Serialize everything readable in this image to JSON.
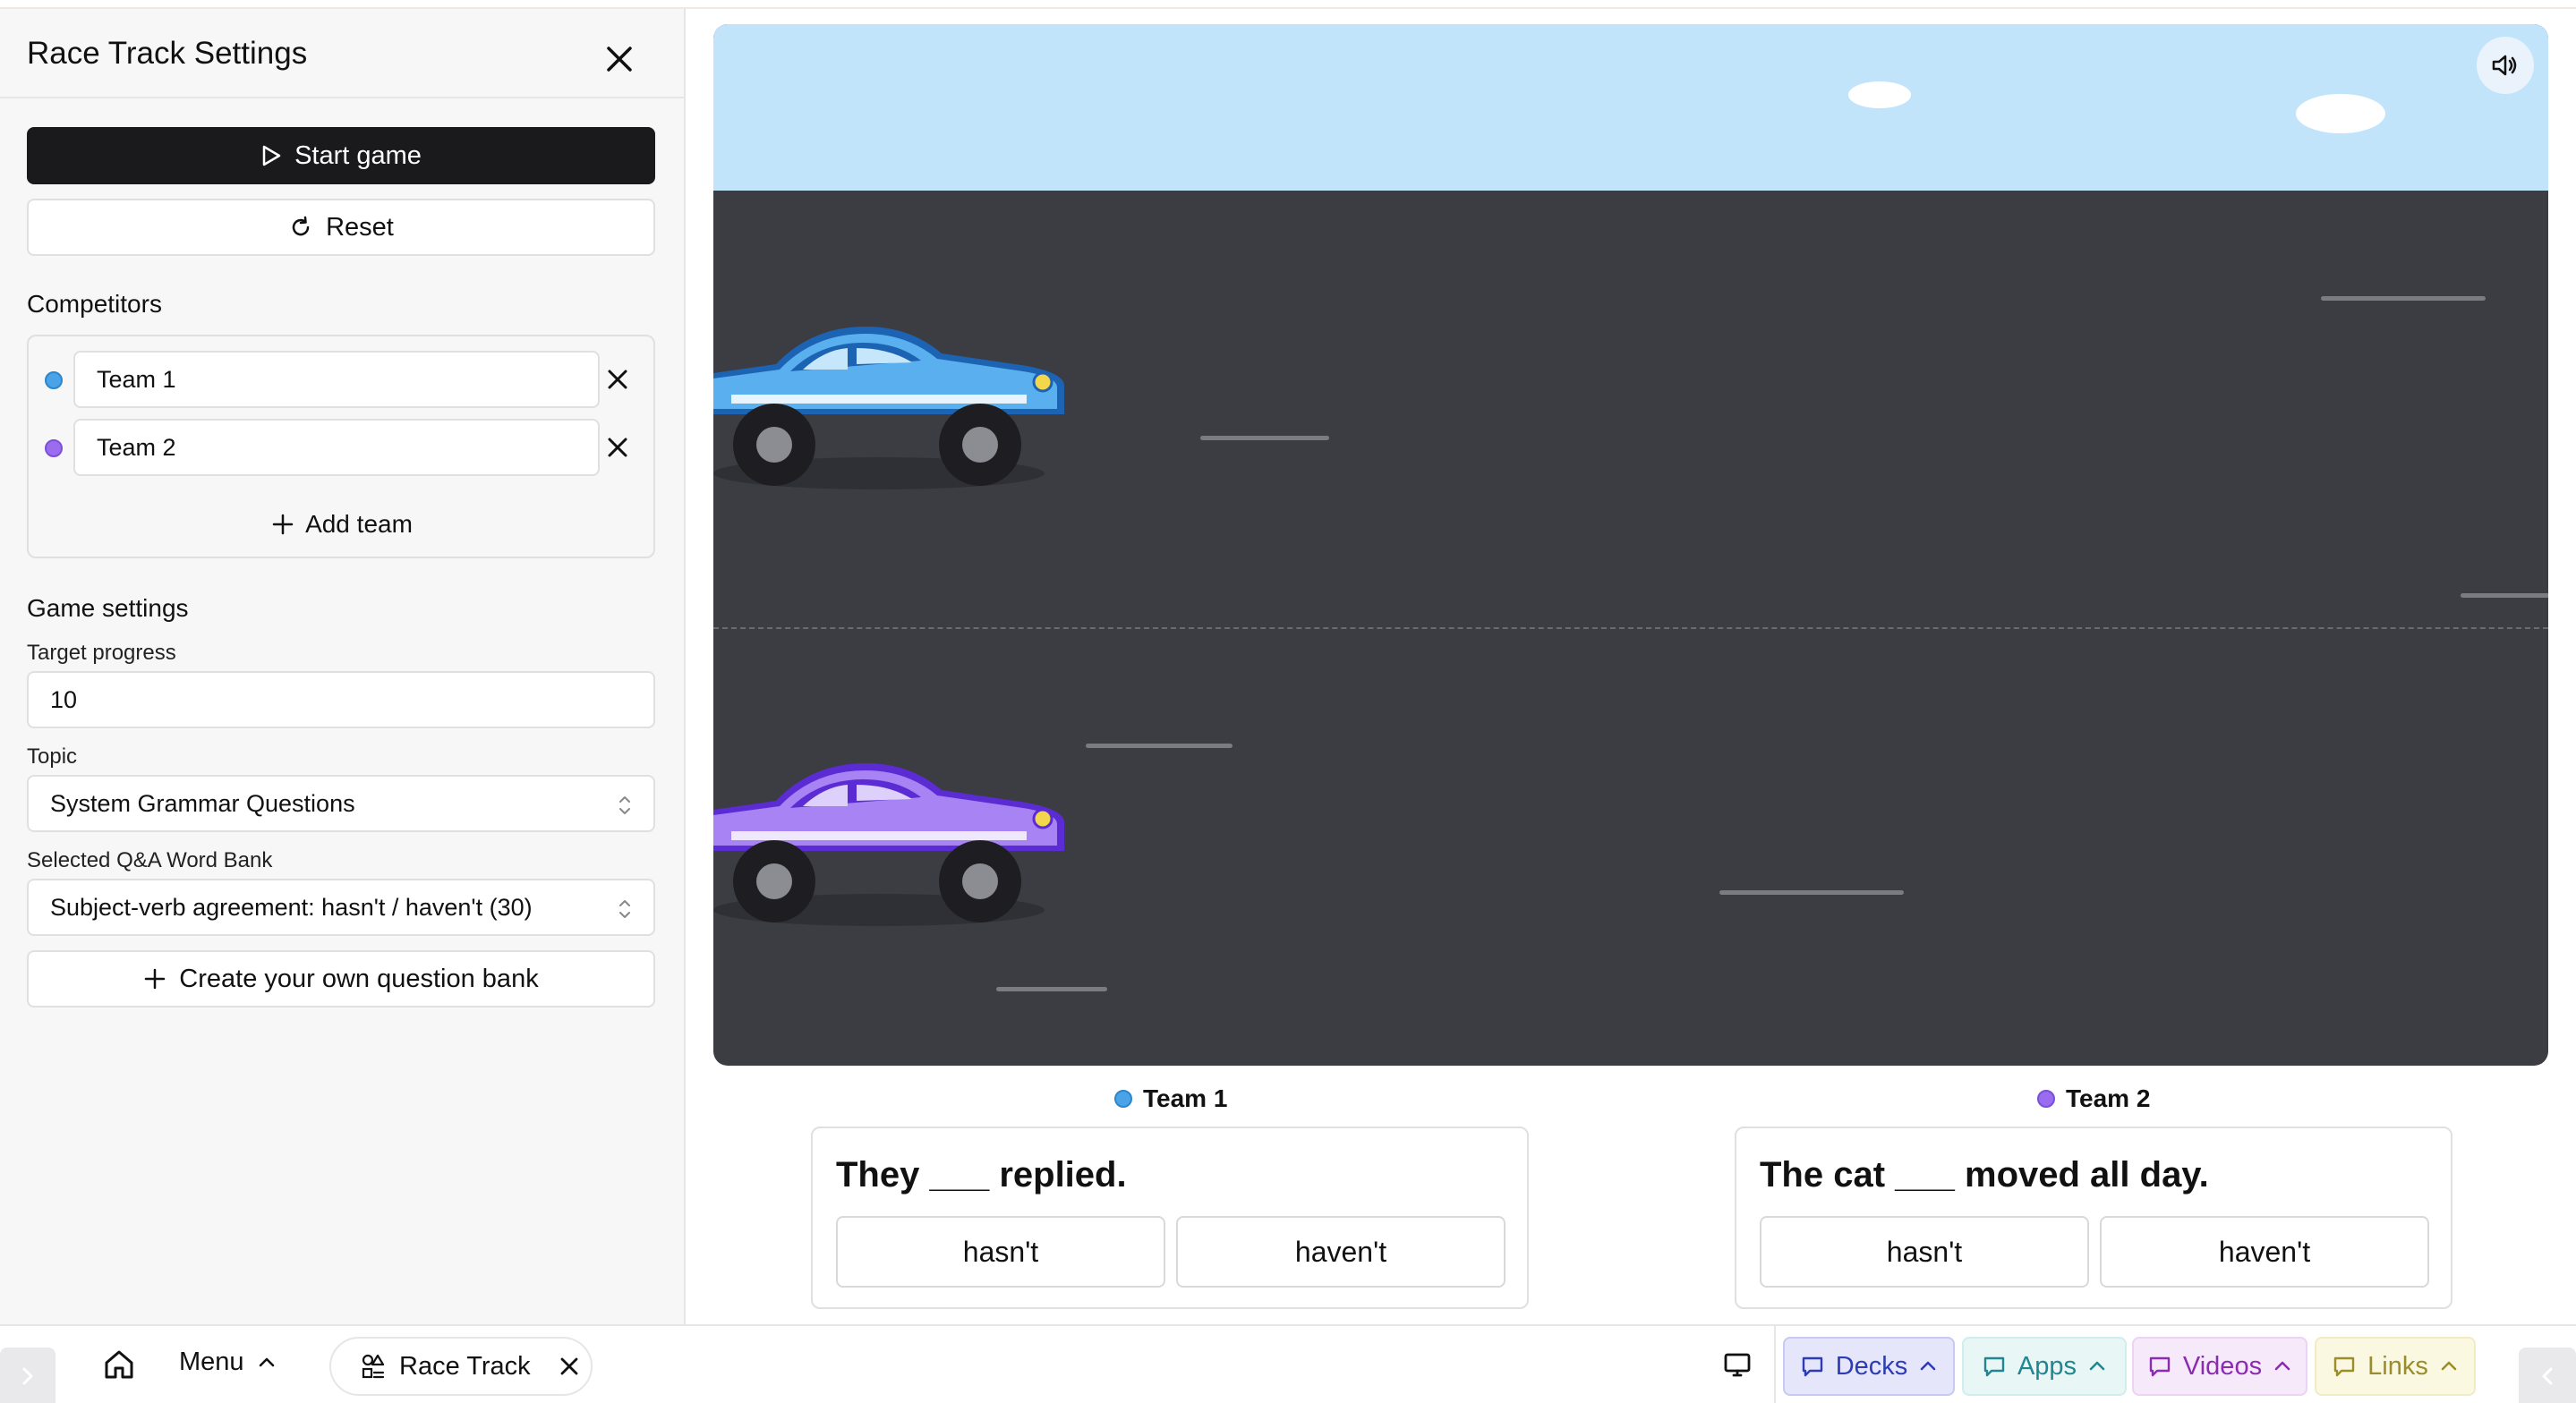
{
  "sidebar": {
    "title": "Race Track Settings",
    "start_label": "Start game",
    "reset_label": "Reset",
    "competitors_label": "Competitors",
    "teams": [
      {
        "name": "Team 1",
        "color": "#4aa3e6"
      },
      {
        "name": "Team 2",
        "color": "#9a6cf0"
      }
    ],
    "add_team_label": "Add team",
    "game_settings_label": "Game settings",
    "target_progress_label": "Target progress",
    "target_progress_value": "10",
    "topic_label": "Topic",
    "topic_value": "System Grammar Questions",
    "word_bank_label": "Selected Q&A Word Bank",
    "word_bank_value": "Subject-verb agreement: hasn't / haven't (30)",
    "create_bank_label": "Create your own question bank"
  },
  "game": {
    "sky_color": "#c2e4fb",
    "road_color": "#3c3d43",
    "cars": [
      {
        "team": "Team 1",
        "color": "#4aa3e6"
      },
      {
        "team": "Team 2",
        "color": "#9a6cf0"
      }
    ]
  },
  "questions": [
    {
      "team": "Team 1",
      "prompt": "They ___ replied.",
      "answers": [
        "hasn't",
        "haven't"
      ]
    },
    {
      "team": "Team 2",
      "prompt": "The cat ___ moved all day.",
      "answers": [
        "hasn't",
        "haven't"
      ]
    }
  ],
  "bottombar": {
    "menu_label": "Menu",
    "active_app_label": "Race Track",
    "chips": [
      {
        "label": "Decks",
        "color": "#2d3bb5",
        "bg": "#e6e6fb",
        "border": "#c8c8f2"
      },
      {
        "label": "Apps",
        "color": "#21868f",
        "bg": "#e8f6f6",
        "border": "#cfeeee"
      },
      {
        "label": "Videos",
        "color": "#8a2bb0",
        "bg": "#f6e9fa",
        "border": "#ecd3f5"
      },
      {
        "label": "Links",
        "color": "#9a8d2a",
        "bg": "#fbf8e2",
        "border": "#f2ecc4"
      }
    ]
  }
}
